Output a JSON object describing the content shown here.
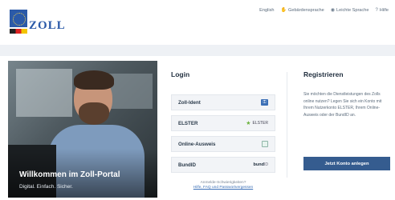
{
  "brand": {
    "logo_text": "ZOLL"
  },
  "topnav": {
    "items": [
      {
        "label": "English",
        "icon": "none"
      },
      {
        "label": "Gebärdensprache",
        "icon": "hand-icon"
      },
      {
        "label": "Leichte Sprache",
        "icon": "book-icon"
      },
      {
        "label": "Hilfe",
        "icon": "question-icon"
      }
    ]
  },
  "hero": {
    "title": "Willkommen im Zoll-Portal",
    "subtitle": "Digital. Einfach. Sicher."
  },
  "login": {
    "title": "Login",
    "options": [
      {
        "label": "Zoll-Ident",
        "badge": ""
      },
      {
        "label": "ELSTER",
        "badge": "ELSTER"
      },
      {
        "label": "Online-Ausweis",
        "badge": ""
      },
      {
        "label": "BundID",
        "badge": "bund",
        "badge_suffix": "ID"
      }
    ],
    "help_line1": "Anmelde-Schwierigkeiten?",
    "help_link": "Hilfe, FAQ und Passwortvergessen"
  },
  "register": {
    "title": "Registrieren",
    "text": "Sie möchten die Dienstleistungen des Zolls online nutzen? Legen Sie sich ein Konto mit Ihrem Nutzerkonto ELSTER, Ihrem Online-Ausweis oder der BundID an.",
    "button_label": "Jetzt Konto anlegen"
  },
  "colors": {
    "brand_blue": "#2b5aa8",
    "button": "#355c8f",
    "band": "#eef1f5"
  }
}
